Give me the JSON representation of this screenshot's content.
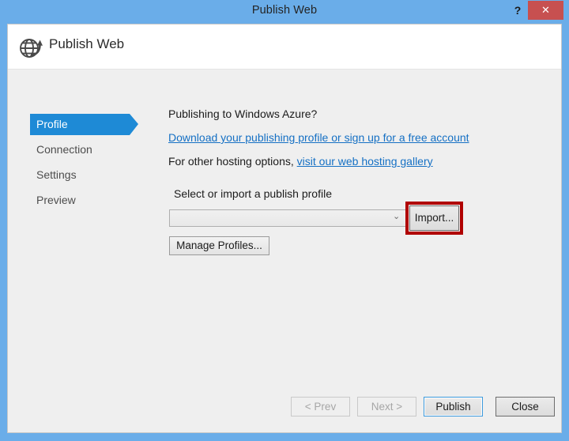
{
  "window": {
    "title": "Publish Web",
    "help_label": "?",
    "close_label": "✕",
    "accent_color": "#6aade9",
    "close_color": "#c75050"
  },
  "dialog": {
    "header_title": "Publish Web",
    "header_icon": "globe-publish-icon",
    "background_color": "#efefef"
  },
  "sidebar": {
    "items": [
      {
        "label": "Profile",
        "selected": true
      },
      {
        "label": "Connection",
        "selected": false
      },
      {
        "label": "Settings",
        "selected": false
      },
      {
        "label": "Preview",
        "selected": false
      }
    ],
    "selected_color": "#1e8ad6"
  },
  "content": {
    "azure_prompt": "Publishing to Windows Azure?",
    "azure_link": "Download your publishing profile or sign up for a free account",
    "hosting_prefix": "For other hosting options,",
    "hosting_link": "visit our web hosting gallery",
    "profile_label": "Select or import a publish profile",
    "profile_combo_value": "",
    "profile_combo_chevron": "⌄",
    "import_label": "Import...",
    "manage_label": "Manage Profiles...",
    "link_color": "#1570c4",
    "annotation_color": "#b00000"
  },
  "footer": {
    "prev_label": "< Prev",
    "next_label": "Next >",
    "publish_label": "Publish",
    "close_label": "Close",
    "prev_enabled": false,
    "next_enabled": false
  }
}
